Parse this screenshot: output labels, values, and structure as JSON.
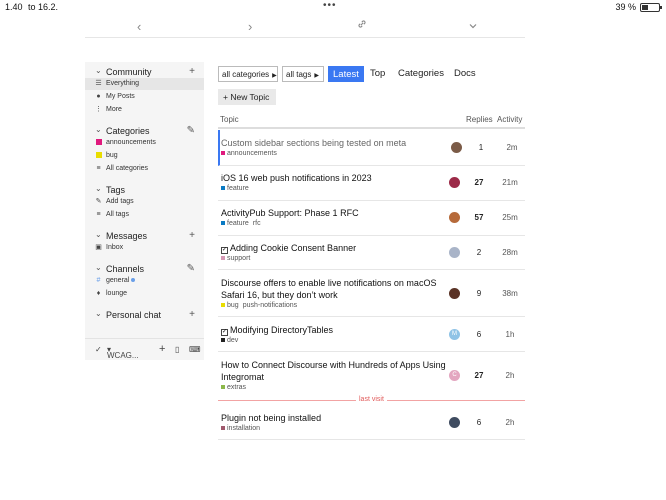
{
  "status": {
    "time": "1.40",
    "date": "to 16.2.",
    "battery": "39 %"
  },
  "toolbar": {
    "back_icon": "chevron-left-icon",
    "forward_icon": "chevron-right-icon",
    "link_icon": "link-icon",
    "menu_icon": "chevron-down-icon"
  },
  "sidebar": {
    "community": {
      "title": "Community",
      "items": [
        {
          "label": "Everything",
          "icon": "stack-icon"
        },
        {
          "label": "My Posts",
          "icon": "user-icon"
        },
        {
          "label": "More",
          "icon": "ellipsis-icon"
        }
      ]
    },
    "categories": {
      "title": "Categories",
      "items": [
        {
          "label": "announcements",
          "color": "#e0197d"
        },
        {
          "label": "bug",
          "color": "#e9dd00"
        },
        {
          "label": "All categories",
          "icon": "list-icon"
        }
      ]
    },
    "tags": {
      "title": "Tags",
      "items": [
        {
          "label": "Add tags",
          "icon": "pencil-icon"
        },
        {
          "label": "All tags",
          "icon": "list-icon"
        }
      ]
    },
    "messages": {
      "title": "Messages",
      "items": [
        {
          "label": "Inbox",
          "icon": "inbox-icon"
        }
      ]
    },
    "channels": {
      "title": "Channels",
      "items": [
        {
          "label": "general",
          "icon": "hash-icon"
        },
        {
          "label": "lounge",
          "icon": "lounge-icon"
        }
      ]
    },
    "personal_chat": {
      "title": "Personal chat"
    },
    "footer": {
      "label": "WCAG..."
    }
  },
  "nav": {
    "categories_dropdown": "all categories",
    "tags_dropdown": "all tags",
    "latest": "Latest",
    "top": "Top",
    "categories": "Categories",
    "docs": "Docs"
  },
  "new_topic": "+ New Topic",
  "table": {
    "col_topic": "Topic",
    "col_replies": "Replies",
    "col_activity": "Activity",
    "rows": [
      {
        "title": "Custom sidebar sections being tested on meta",
        "category": "announcements",
        "category_color": "#e0197d",
        "tags": "",
        "replies": "1",
        "activity": "2m",
        "avatar_color": "#7b5b47"
      },
      {
        "title": "iOS 16 web push notifications in 2023",
        "category": "feature",
        "category_color": "#0a7ac3",
        "tags": "",
        "replies": "27",
        "activity": "21m",
        "avatar_color": "#9c2a48"
      },
      {
        "title": "ActivityPub Support: Phase 1 RFC",
        "category": "feature",
        "category_color": "#0a7ac3",
        "tags": "rfc",
        "replies": "57",
        "activity": "25m",
        "avatar_color": "#b66a3a"
      },
      {
        "title": "Adding Cookie Consent Banner",
        "category": "support",
        "category_color": "#d79ab6",
        "tags": "",
        "replies": "2",
        "activity": "28m",
        "avatar_color": "#a9b4c8"
      },
      {
        "title": "Discourse offers to enable live notifications on macOS Safari 16, but they don’t work",
        "category": "bug",
        "category_color": "#e9dd00",
        "tags": "push-notifications",
        "replies": "9",
        "activity": "38m",
        "avatar_color": "#5a3326"
      },
      {
        "title": "Modifying DirectoryTables",
        "category": "dev",
        "category_color": "#222222",
        "tags": "",
        "replies": "6",
        "activity": "1h",
        "avatar_color": "#8fc3e6",
        "avatar_letter": "M"
      },
      {
        "title": "How to Connect Discourse with Hundreds of Apps Using Integromat",
        "category": "extras",
        "category_color": "#8cb84a",
        "tags": "",
        "replies": "27",
        "activity": "2h",
        "avatar_color": "#e3a6c0",
        "avatar_letter": "C"
      },
      {
        "title": "Plugin not being installed",
        "category": "installation",
        "category_color": "#a0596d",
        "tags": "",
        "replies": "6",
        "activity": "2h",
        "avatar_color": "#3f4c60"
      }
    ]
  },
  "last_visit": "last visit"
}
